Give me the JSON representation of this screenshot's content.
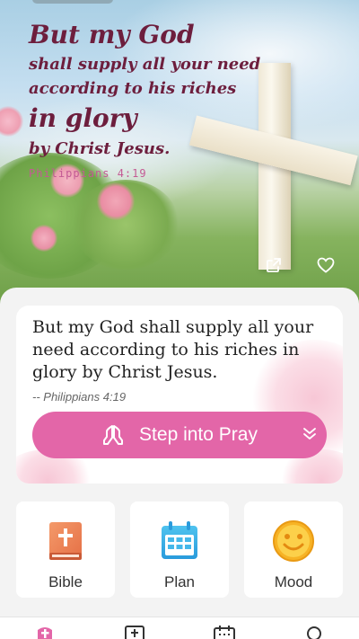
{
  "hero": {
    "line1": "But my God",
    "line2": "shall supply all your need",
    "line3": "according to his riches",
    "line4": "in glory",
    "line5": "by Christ Jesus.",
    "reference": "Philippians 4:19",
    "icons": [
      "share-icon",
      "heart-icon"
    ]
  },
  "verse_card": {
    "text": "But my God shall supply all your need according to his riches in glory by Christ Jesus.",
    "reference": "-- Philippians 4:19",
    "pray_button": "Step into Pray"
  },
  "tiles": [
    {
      "label": "Bible",
      "icon": "bible-icon"
    },
    {
      "label": "Plan",
      "icon": "calendar-icon"
    },
    {
      "label": "Mood",
      "icon": "smiley-icon"
    }
  ],
  "tabs": [
    {
      "icon": "home-cross-icon",
      "active": true
    },
    {
      "icon": "bible-tab-icon",
      "active": false
    },
    {
      "icon": "plan-tab-icon",
      "active": false
    },
    {
      "icon": "search-tab-icon",
      "active": false
    }
  ],
  "colors": {
    "accent": "#e366a8",
    "verse_art": "#6d1e3d",
    "reference_art": "#c45a94"
  }
}
